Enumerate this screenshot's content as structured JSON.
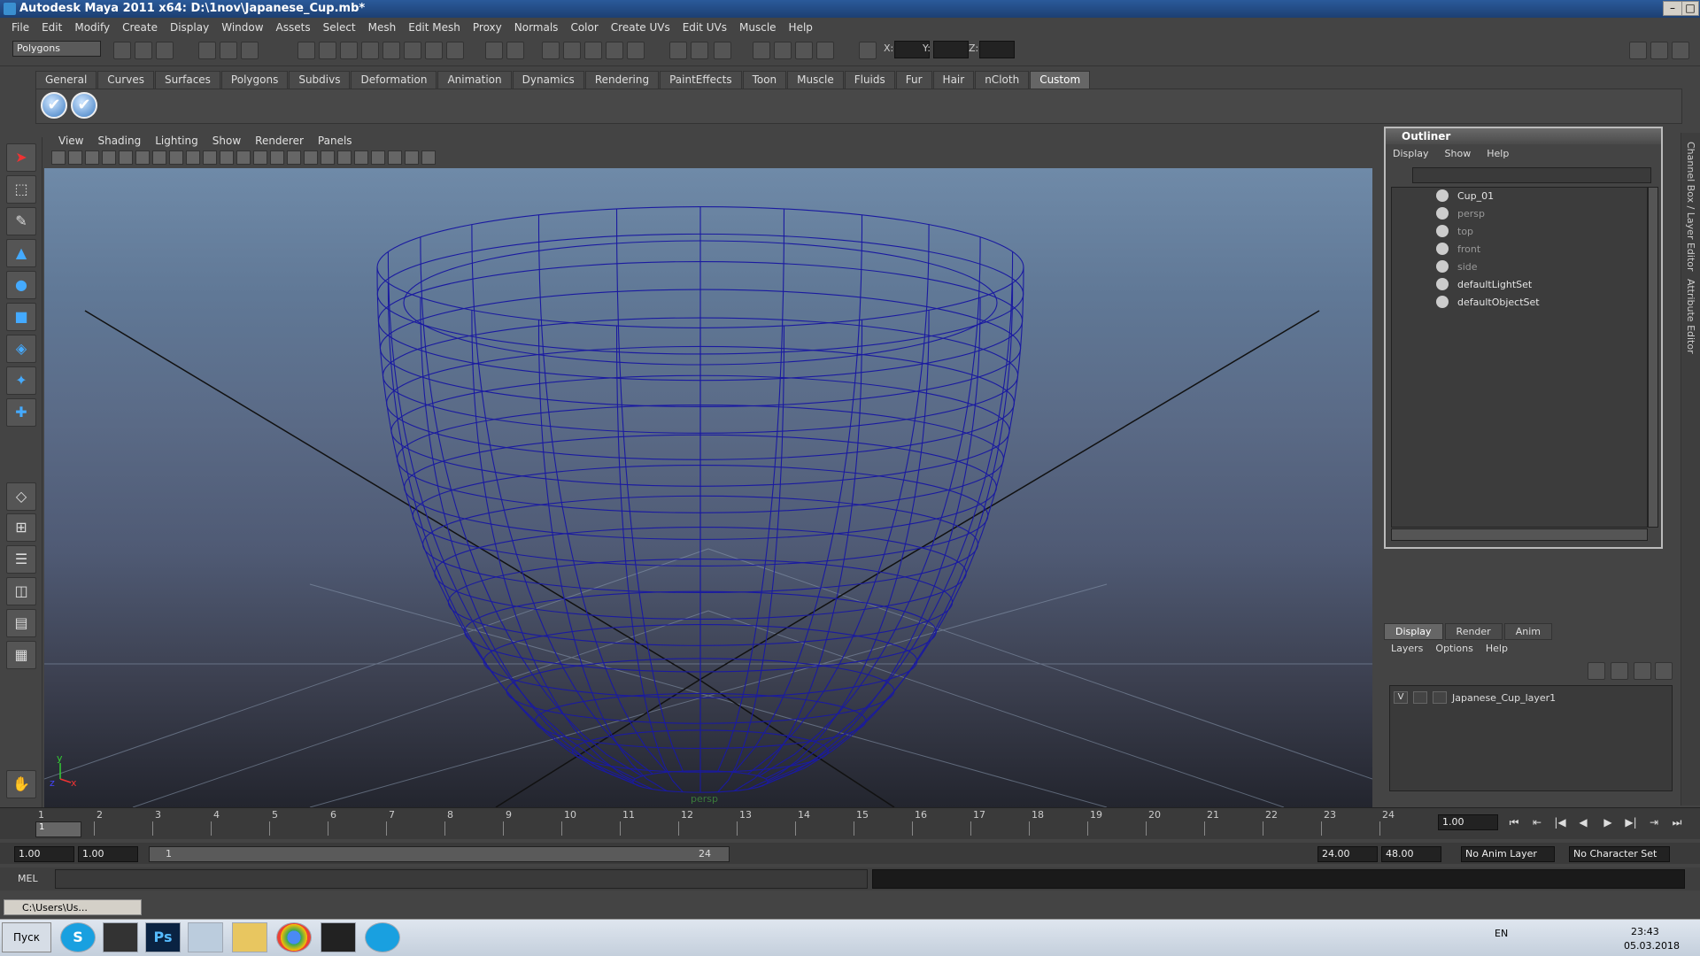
{
  "window": {
    "title": "Autodesk Maya 2011 x64: D:\\1nov\\Japanese_Cup.mb*",
    "min": "–",
    "max": "□",
    "close": "✕"
  },
  "menu": [
    "File",
    "Edit",
    "Modify",
    "Create",
    "Display",
    "Window",
    "Assets",
    "Select",
    "Mesh",
    "Edit Mesh",
    "Proxy",
    "Normals",
    "Color",
    "Create UVs",
    "Edit UVs",
    "Muscle",
    "Help"
  ],
  "status": {
    "mode": "Polygons",
    "x_label": "X:",
    "y_label": "Y:",
    "z_label": "Z:"
  },
  "shelf": {
    "tabs": [
      "General",
      "Curves",
      "Surfaces",
      "Polygons",
      "Subdivs",
      "Deformation",
      "Animation",
      "Dynamics",
      "Rendering",
      "PaintEffects",
      "Toon",
      "Muscle",
      "Fluids",
      "Fur",
      "Hair",
      "nCloth",
      "Custom"
    ],
    "active": "Custom",
    "check_icon": "✔"
  },
  "viewport": {
    "menu": [
      "View",
      "Shading",
      "Lighting",
      "Show",
      "Renderer",
      "Panels"
    ],
    "camera_label": "persp",
    "axis_y": "y",
    "axis_x": "x",
    "axis_z": "z",
    "wire_color": "#1a1aa0"
  },
  "outliner": {
    "title": "Outliner",
    "menu": [
      "Display",
      "Show",
      "Help"
    ],
    "items": [
      {
        "label": "Cup_01",
        "dim": false
      },
      {
        "label": "persp",
        "dim": true
      },
      {
        "label": "top",
        "dim": true
      },
      {
        "label": "front",
        "dim": true
      },
      {
        "label": "side",
        "dim": true
      },
      {
        "label": "defaultLightSet",
        "dim": false
      },
      {
        "label": "defaultObjectSet",
        "dim": false
      }
    ]
  },
  "side_tabs": {
    "channel": "Channel Box / Layer Editor",
    "attr": "Attribute Editor"
  },
  "layers": {
    "tabs": [
      "Display",
      "Render",
      "Anim"
    ],
    "active": "Display",
    "menu": [
      "Layers",
      "Options",
      "Help"
    ],
    "row": {
      "visible": "V",
      "name": "Japanese_Cup_layer1"
    }
  },
  "timeline": {
    "ticks": [
      "1",
      "2",
      "3",
      "4",
      "5",
      "6",
      "7",
      "8",
      "9",
      "10",
      "11",
      "12",
      "13",
      "14",
      "15",
      "16",
      "17",
      "18",
      "19",
      "20",
      "21",
      "22",
      "23",
      "24"
    ],
    "current": "1.00",
    "current_marker": "1"
  },
  "range": {
    "start": "1.00",
    "start2": "1.00",
    "slider_start": "1",
    "slider_end": "24",
    "end": "24.00",
    "end2": "48.00",
    "anim_layer": "No Anim Layer",
    "char_set": "No Character Set"
  },
  "mel": {
    "label": "MEL"
  },
  "mini": {
    "title": "C:\\Users\\Us..."
  },
  "taskbar": {
    "start": "Пуск",
    "lang": "EN",
    "time": "23:43",
    "date": "05.03.2018",
    "apps": [
      "S",
      "",
      "Ps",
      "",
      "",
      "",
      "",
      ""
    ]
  }
}
